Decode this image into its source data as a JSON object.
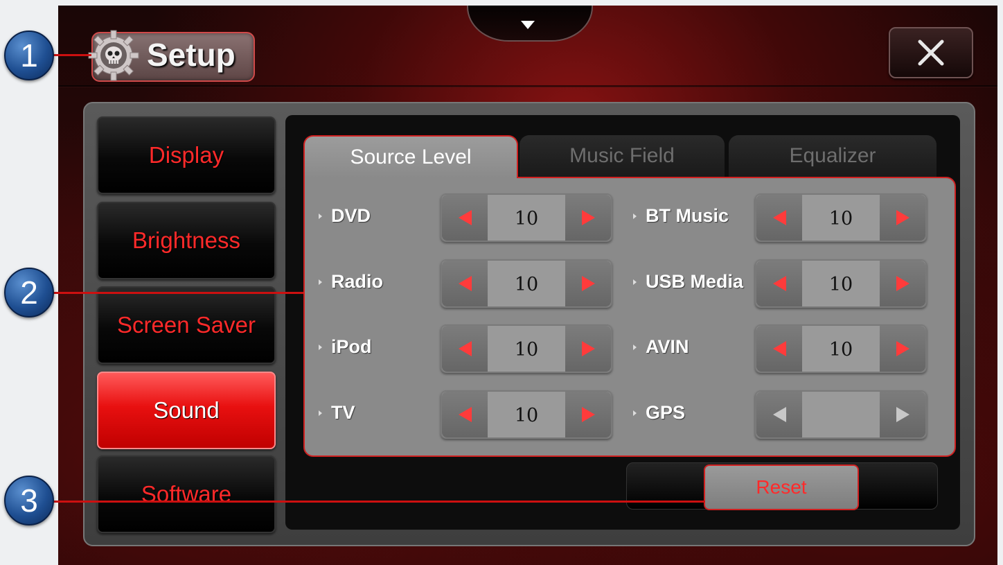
{
  "header": {
    "title": "Setup",
    "close_icon": "close-icon",
    "gear_icon": "gear-skull-icon",
    "pull_down_icon": "pull-down-arrow-icon"
  },
  "sidebar": {
    "items": [
      {
        "label": "Display",
        "active": false
      },
      {
        "label": "Brightness",
        "active": false
      },
      {
        "label": "Screen Saver",
        "active": false
      },
      {
        "label": "Sound",
        "active": true
      },
      {
        "label": "Software",
        "active": false
      }
    ]
  },
  "tabs": [
    {
      "label": "Source Level",
      "active": true
    },
    {
      "label": "Music Field",
      "active": false
    },
    {
      "label": "Equalizer",
      "active": false
    }
  ],
  "levels": [
    {
      "label": "DVD",
      "value": "10"
    },
    {
      "label": "BT Music",
      "value": "10"
    },
    {
      "label": "Radio",
      "value": "10"
    },
    {
      "label": "USB Media",
      "value": "10"
    },
    {
      "label": "iPod",
      "value": "10"
    },
    {
      "label": "AVIN",
      "value": "10"
    },
    {
      "label": "TV",
      "value": "10"
    },
    {
      "label": "GPS",
      "value": ""
    }
  ],
  "reset_label": "Reset",
  "callouts": [
    "1",
    "2",
    "3"
  ],
  "colors": {
    "accent_red": "#ff2a2a",
    "active_button": "#e81010",
    "callout_blue": "#1f4f92"
  }
}
